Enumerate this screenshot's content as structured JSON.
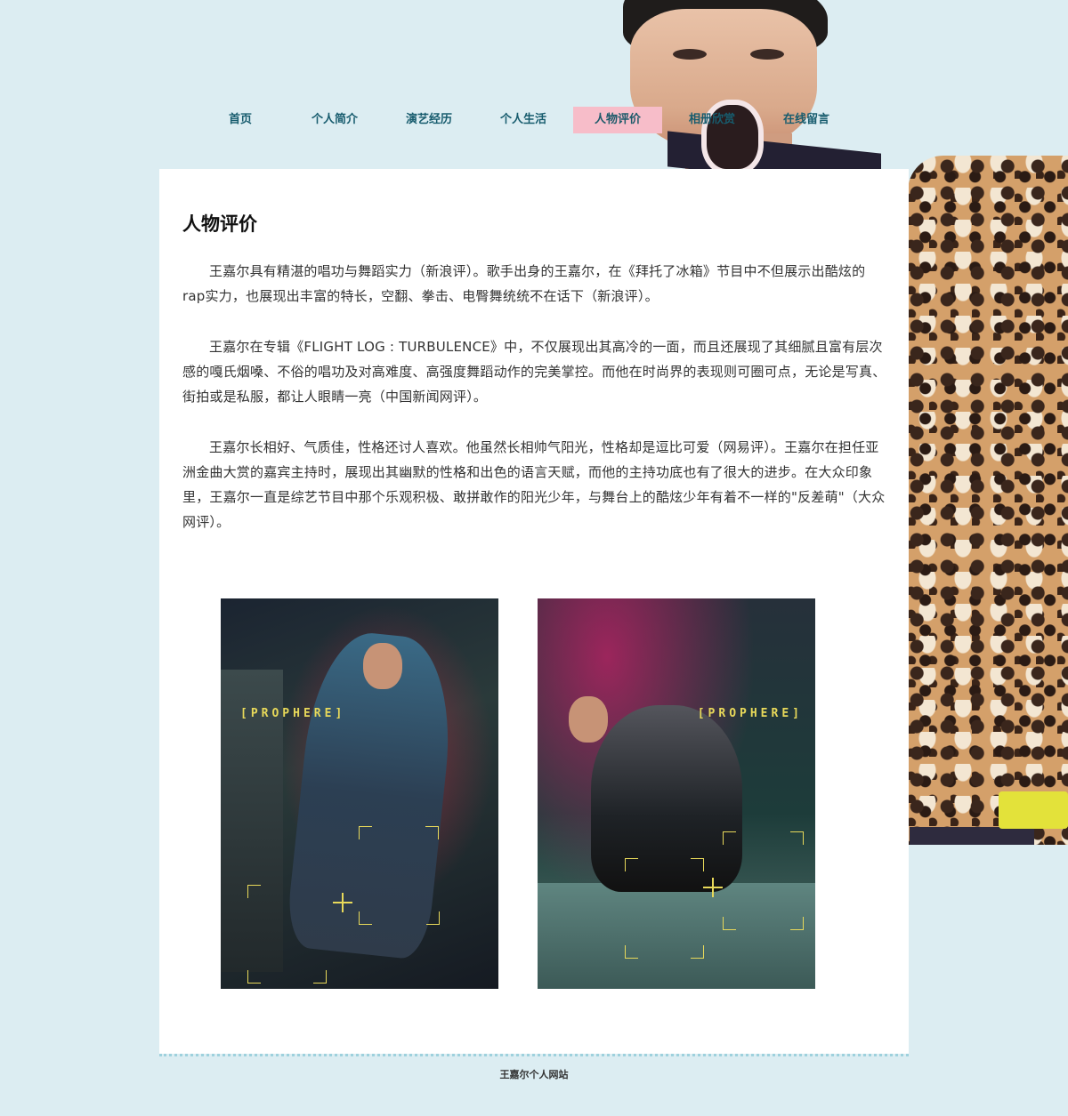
{
  "nav": {
    "items": [
      {
        "label": "首页"
      },
      {
        "label": "个人简介"
      },
      {
        "label": "演艺经历"
      },
      {
        "label": "个人生活"
      },
      {
        "label": "人物评价"
      },
      {
        "label": "相册欣赏"
      },
      {
        "label": "在线留言"
      }
    ],
    "active_index": 4
  },
  "main": {
    "title": "人物评价",
    "paragraphs": [
      "王嘉尔具有精湛的唱功与舞蹈实力（新浪评）。歌手出身的王嘉尔，在《拜托了冰箱》节目中不但展示出酷炫的rap实力，也展现出丰富的特长，空翻、拳击、电臀舞统统不在话下（新浪评）。",
      " 王嘉尔在专辑《FLIGHT LOG : TURBULENCE》中，不仅展现出其高冷的一面，而且还展现了其细腻且富有层次感的嘎氏烟嗓、不俗的唱功及对高难度、高强度舞蹈动作的完美掌控。而他在时尚界的表现则可圈可点，无论是写真、街拍或是私服，都让人眼睛一亮（中国新闻网评）。",
      "王嘉尔长相好、气质佳，性格还讨人喜欢。他虽然长相帅气阳光，性格却是逗比可爱（网易评）。王嘉尔在担任亚洲金曲大赏的嘉宾主持时，展现出其幽默的性格和出色的语言天赋，而他的主持功底也有了很大的进步。在大众印象里，王嘉尔一直是综艺节目中那个乐观积极、敢拼敢作的阳光少年，与舞台上的酷炫少年有着不一样的\"反差萌\"（大众网评）。"
    ],
    "photos": [
      {
        "brand_text": "[PROPHERE]"
      },
      {
        "brand_text": "[PROPHERE]"
      }
    ]
  },
  "footer": {
    "text": "王嘉尔个人网站"
  },
  "colors": {
    "page_background": "#dcedf2",
    "nav_text": "#175c6e",
    "nav_active_background": "#f7bdc9",
    "card_background": "#ffffff",
    "brand_yellow": "#e8d95a"
  }
}
